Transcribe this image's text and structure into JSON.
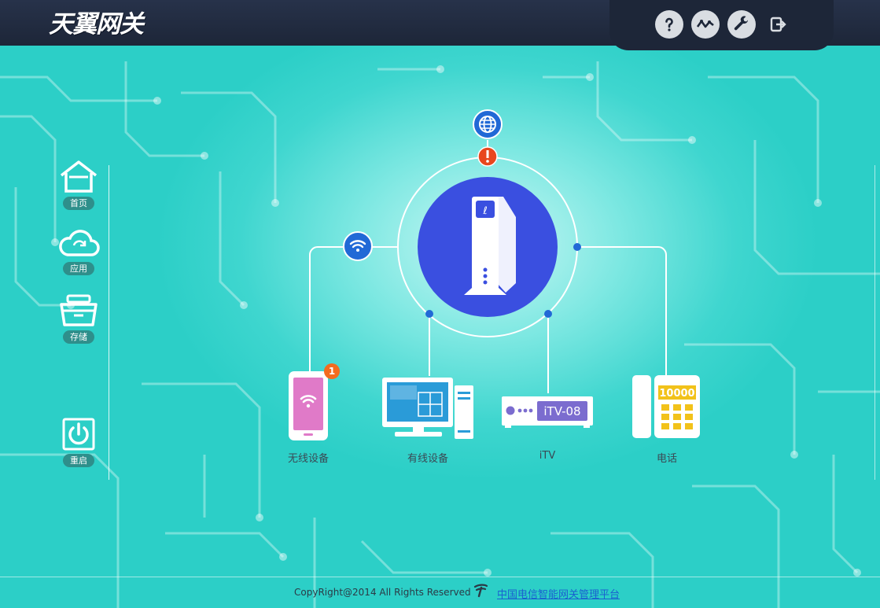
{
  "header": {
    "logo": "天翼网关",
    "icons": [
      "help-icon",
      "network-status-icon",
      "settings-wrench-icon",
      "logout-icon"
    ]
  },
  "sidebar": {
    "items": [
      {
        "label": "首页",
        "icon": "home-icon"
      },
      {
        "label": "应用",
        "icon": "cloud-icon"
      },
      {
        "label": "存储",
        "icon": "storage-icon"
      },
      {
        "label": "重启",
        "icon": "power-icon"
      }
    ]
  },
  "topology": {
    "gateway": "gateway-device-icon",
    "internet": "globe-icon",
    "alert": "!",
    "devices": [
      {
        "label": "无线设备",
        "icon": "phone-wifi-icon",
        "badge": "1"
      },
      {
        "label": "有线设备",
        "icon": "desktop-computer-icon"
      },
      {
        "label": "iTV",
        "icon": "settop-box-icon",
        "screen_text": "iTV-08"
      },
      {
        "label": "电话",
        "icon": "telephone-icon",
        "screen_text": "10000"
      }
    ]
  },
  "footer": {
    "copyright": "CopyRight@2014 All Rights Reserved",
    "link": "中国电信智能网关管理平台"
  },
  "colors": {
    "accent_blue": "#3a4fe0",
    "badge_orange": "#f36c1e",
    "topbar": "#1d2638",
    "background": "#3fd6cf"
  }
}
